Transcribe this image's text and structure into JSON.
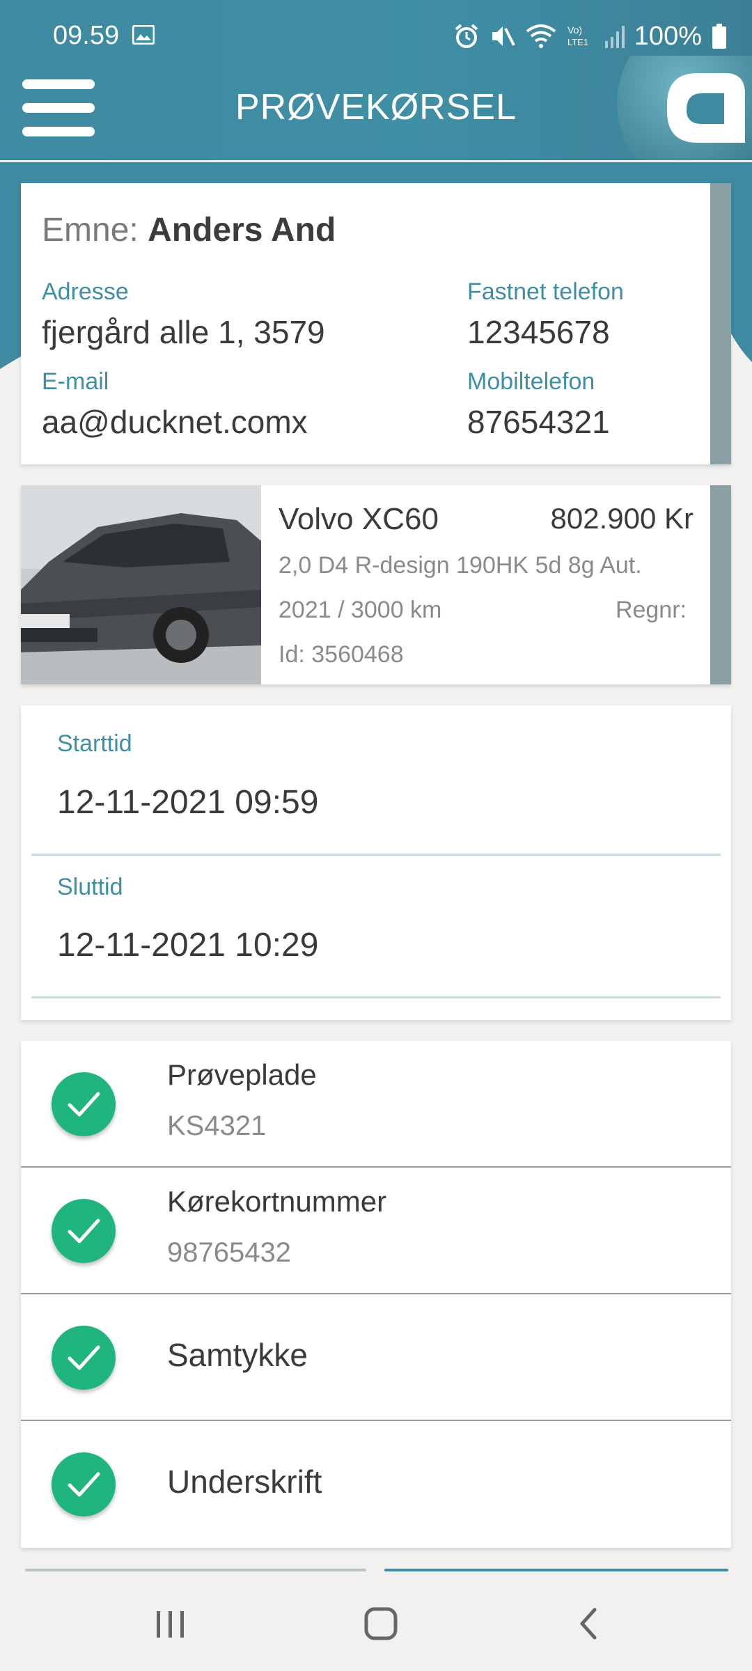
{
  "status_bar": {
    "time": "09.59",
    "battery": "100%",
    "icons": [
      "image-icon",
      "alarm-icon",
      "mute-icon",
      "wifi-icon",
      "volte-icon",
      "signal-icon",
      "battery-icon"
    ]
  },
  "app_bar": {
    "title": "PRØVEKØRSEL",
    "menu_icon": "hamburger-menu-icon",
    "logo": "brand-logo"
  },
  "customer": {
    "subject_label": "Emne:",
    "subject_name": "Anders And",
    "address_label": "Adresse",
    "address_value": "fjergård alle 1, 3579",
    "landline_label": "Fastnet telefon",
    "landline_value": "12345678",
    "email_label": "E-mail",
    "email_value": "aa@ducknet.comx",
    "mobile_label": "Mobiltelefon",
    "mobile_value": "87654321"
  },
  "car": {
    "name": "Volvo XC60",
    "price": "802.900 Kr",
    "variant": "2,0 D4 R-design 190HK 5d 8g Aut.",
    "year_km": "2021 / 3000 km",
    "regnr_label": "Regnr:",
    "id": "Id: 3560468"
  },
  "times": {
    "start_label": "Starttid",
    "start_value": "12-11-2021 09:59",
    "end_label": "Sluttid",
    "end_value": "12-11-2021 10:29"
  },
  "checklist": [
    {
      "title": "Prøveplade",
      "value": "KS4321",
      "done": true
    },
    {
      "title": "Kørekortnummer",
      "value": "98765432",
      "done": true
    },
    {
      "title": "Samtykke",
      "done": true
    },
    {
      "title": "Underskrift",
      "done": true
    }
  ],
  "colors": {
    "header": "#3f8fa5",
    "accent_label": "#3f8ea3",
    "check_green": "#1fb57c",
    "side_strip": "#8a9fa3"
  },
  "nav_bar": {
    "buttons": [
      "recent-apps-icon",
      "home-icon",
      "back-icon"
    ]
  }
}
